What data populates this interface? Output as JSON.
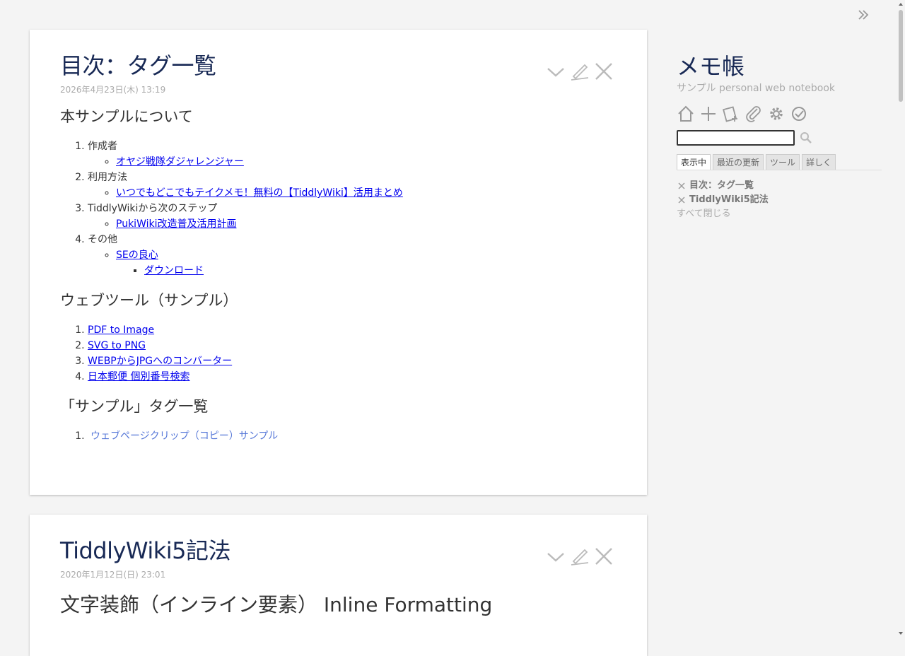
{
  "colors": {
    "title": "#182955",
    "link": "#0000ee",
    "tag_link": "#5778d8",
    "muted": "#aaaaaa",
    "background": "#f4f4f4"
  },
  "tiddlers": [
    {
      "title": "目次：タグ一覧",
      "date": "2026年4月23日(木) 13:19",
      "sections": {
        "about": {
          "heading": "本サンプルについて",
          "items": [
            {
              "label": "作成者",
              "link": "オヤジ戦隊ダジャレンジャー"
            },
            {
              "label": "利用方法",
              "link": "いつでもどこでもテイクメモ！無料の【TiddlyWiki】活用まとめ"
            },
            {
              "label": "TiddlyWikiから次のステップ",
              "link": "PukiWiki改造普及活用計画"
            },
            {
              "label": "その他",
              "link": "SEの良心",
              "sublink": "ダウンロード"
            }
          ]
        },
        "webtools": {
          "heading": "ウェブツール（サンプル）",
          "links": [
            "PDF to Image",
            "SVG to PNG",
            "WEBPからJPGへのコンバーター",
            "日本郵便 個別番号検索"
          ]
        },
        "tag_list": {
          "heading": "「サンプル」タグ一覧",
          "links": [
            "ウェブページクリップ（コピー）サンプル"
          ]
        }
      }
    },
    {
      "title": "TiddlyWiki5記法",
      "date": "2020年1月12日(日) 23:01",
      "heading": "文字装飾（インライン要素） Inline Formatting"
    }
  ],
  "sidebar": {
    "site_title": "メモ帳",
    "site_subtitle": "サンプル personal web notebook",
    "page_controls": [
      "home-icon",
      "new-tiddler-icon",
      "new-journal-icon",
      "import-icon",
      "control-panel-icon",
      "save-icon"
    ],
    "search": {
      "value": "",
      "placeholder": ""
    },
    "tabs": [
      "表示中",
      "最近の更新",
      "ツール",
      "詳しく"
    ],
    "active_tab": "表示中",
    "open_tiddlers": [
      "目次：タグ一覧",
      "TiddlyWiki5記法"
    ],
    "close_all": "すべて閉じる"
  }
}
